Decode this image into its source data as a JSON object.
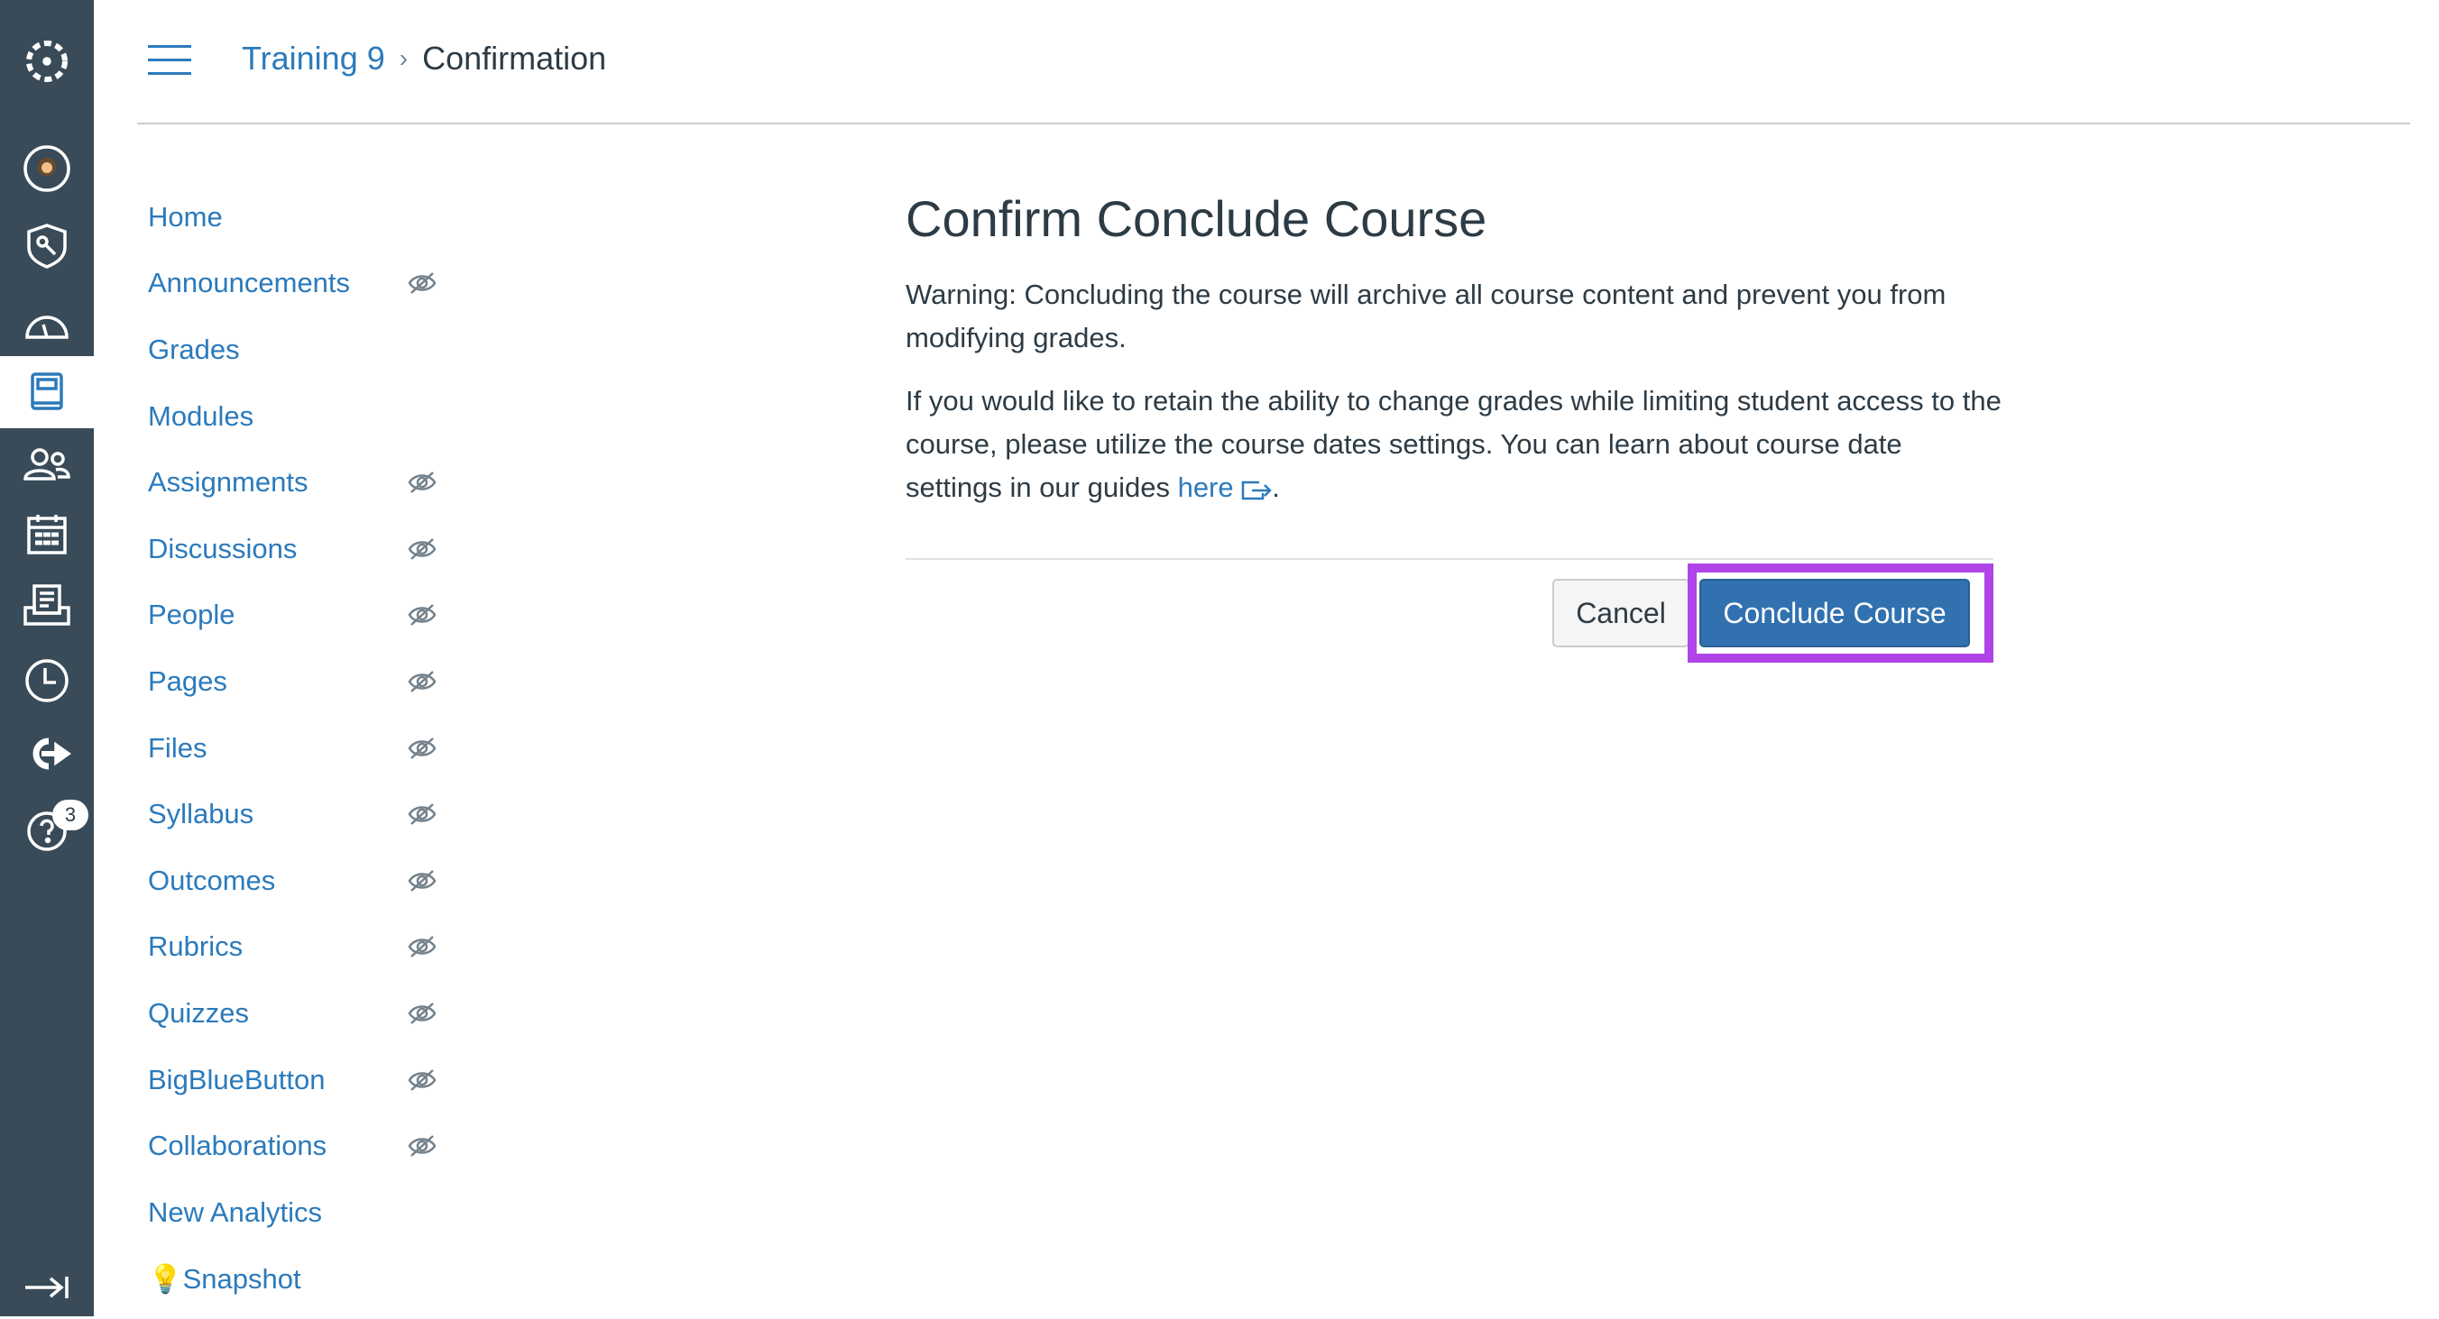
{
  "global_nav": {
    "items": [
      "logo",
      "account",
      "admin",
      "dashboard",
      "courses",
      "groups",
      "calendar",
      "inbox",
      "history",
      "commons",
      "help"
    ],
    "help_badge": "3",
    "active": "courses"
  },
  "breadcrumb": {
    "course": "Training 9",
    "current": "Confirmation"
  },
  "course_nav": [
    {
      "label": "Home",
      "hidden": false
    },
    {
      "label": "Announcements",
      "hidden": true
    },
    {
      "label": "Grades",
      "hidden": false
    },
    {
      "label": "Modules",
      "hidden": false
    },
    {
      "label": "Assignments",
      "hidden": true
    },
    {
      "label": "Discussions",
      "hidden": true
    },
    {
      "label": "People",
      "hidden": true
    },
    {
      "label": "Pages",
      "hidden": true
    },
    {
      "label": "Files",
      "hidden": true
    },
    {
      "label": "Syllabus",
      "hidden": true
    },
    {
      "label": "Outcomes",
      "hidden": true
    },
    {
      "label": "Rubrics",
      "hidden": true
    },
    {
      "label": "Quizzes",
      "hidden": true
    },
    {
      "label": "BigBlueButton",
      "hidden": true
    },
    {
      "label": "Collaborations",
      "hidden": true
    },
    {
      "label": "New Analytics",
      "hidden": false
    },
    {
      "label": "💡Snapshot",
      "hidden": false
    }
  ],
  "main": {
    "title": "Confirm Conclude Course",
    "warning": "Warning: Concluding the course will archive all course content and prevent you from modifying grades.",
    "info": "If you would like to retain the ability to change grades while limiting student access to the course, please utilize the course dates settings. You can learn about course date settings in our guides ",
    "link": "here",
    "cancel": "Cancel",
    "conclude": "Conclude Course"
  },
  "colors": {
    "nav_bg": "#394b58",
    "link": "#2b7abc",
    "primary": "#3171b0",
    "highlight": "#b044e8"
  }
}
